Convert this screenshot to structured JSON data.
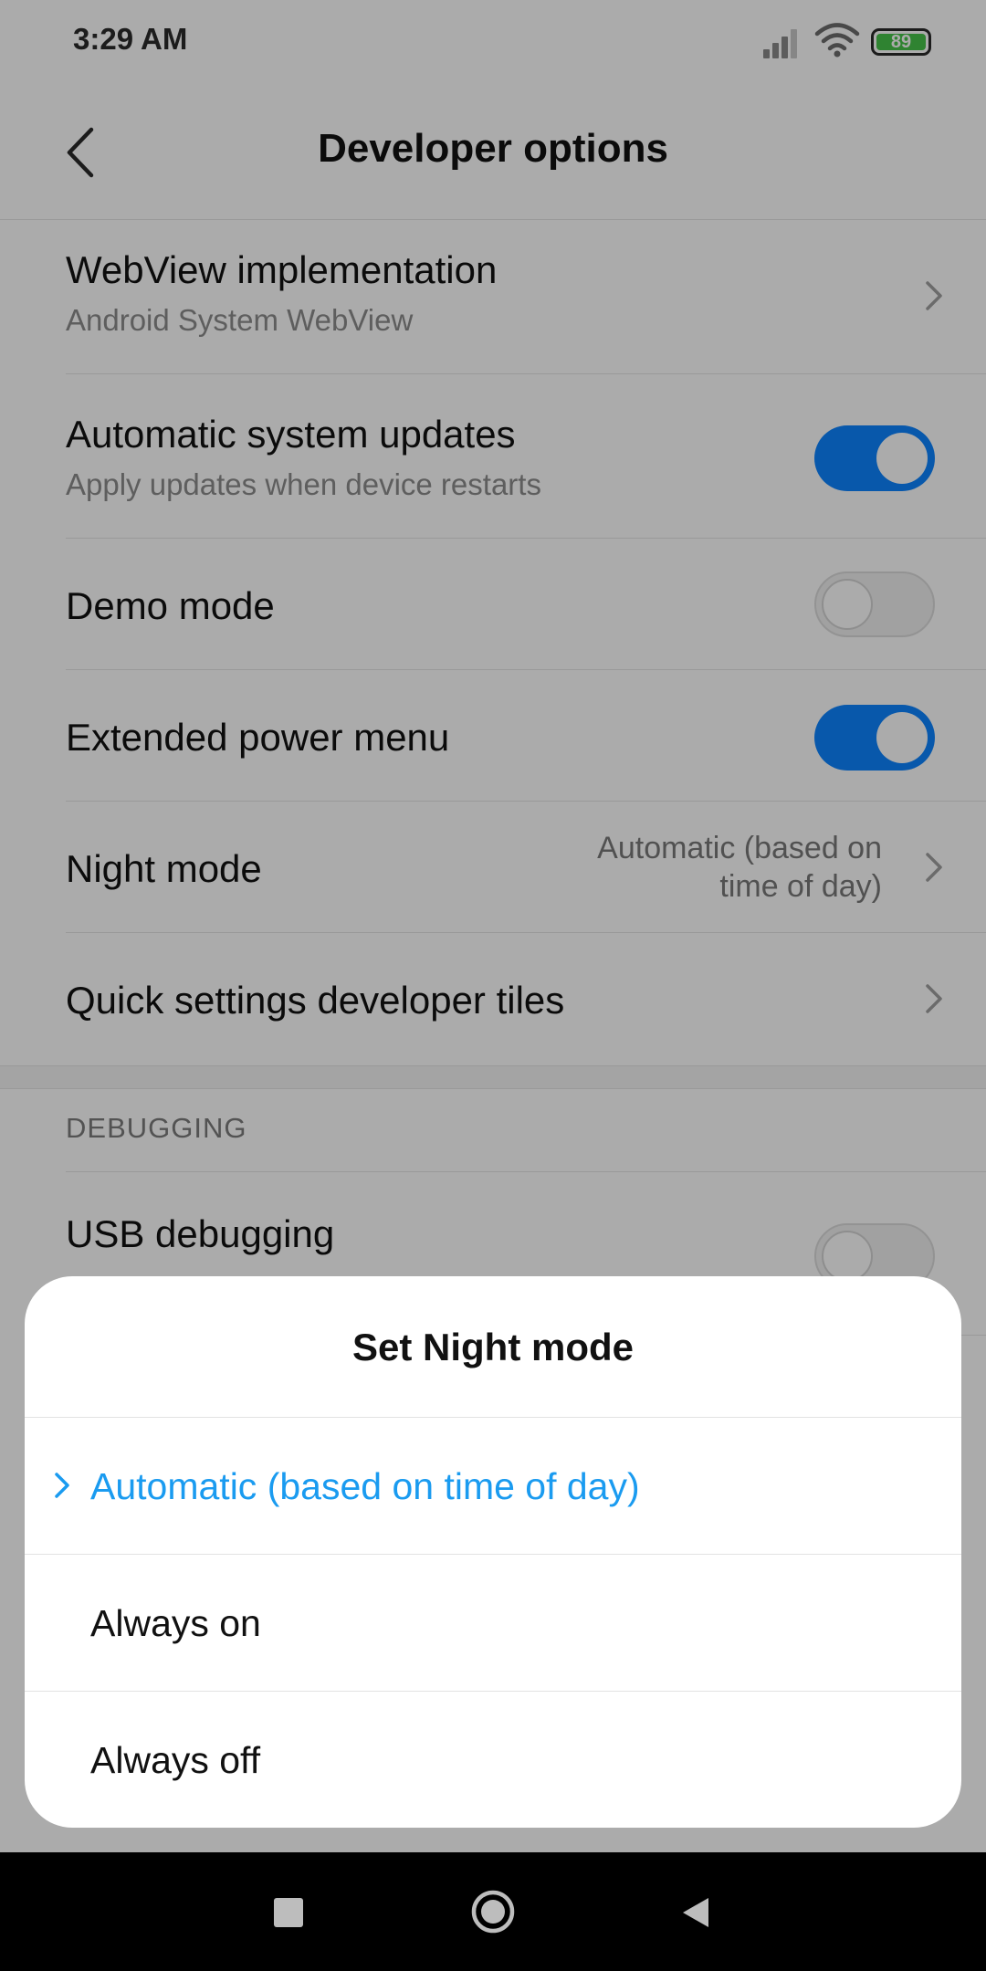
{
  "status_bar": {
    "time": "3:29 AM",
    "battery": "89"
  },
  "header": {
    "title": "Developer options"
  },
  "settings": {
    "webview": {
      "title": "WebView implementation",
      "subtitle": "Android System WebView"
    },
    "auto_updates": {
      "title": "Automatic system updates",
      "subtitle": "Apply updates when device restarts",
      "enabled": true
    },
    "demo_mode": {
      "title": "Demo mode",
      "enabled": false
    },
    "extended_power": {
      "title": "Extended power menu",
      "enabled": true
    },
    "night_mode": {
      "title": "Night mode",
      "value_line1": "Automatic (based on",
      "value_line2": "time of day)"
    },
    "quick_tiles": {
      "title": "Quick settings developer tiles"
    },
    "section_debugging": "DEBUGGING",
    "usb_debugging": {
      "title": "USB debugging",
      "enabled": false
    }
  },
  "dialog": {
    "title": "Set Night mode",
    "options": [
      {
        "label": "Automatic (based on time of day)",
        "selected": true
      },
      {
        "label": "Always on",
        "selected": false
      },
      {
        "label": "Always off",
        "selected": false
      }
    ]
  },
  "colors": {
    "accent": "#0d84ff",
    "selected_text": "#1a9bf0",
    "battery": "#47c34a"
  },
  "icons": [
    "back-arrow-icon",
    "chevron-right-icon",
    "signal-icon",
    "wifi-icon",
    "battery-icon",
    "check-chevron-icon",
    "recents-icon",
    "home-icon",
    "back-nav-icon"
  ]
}
